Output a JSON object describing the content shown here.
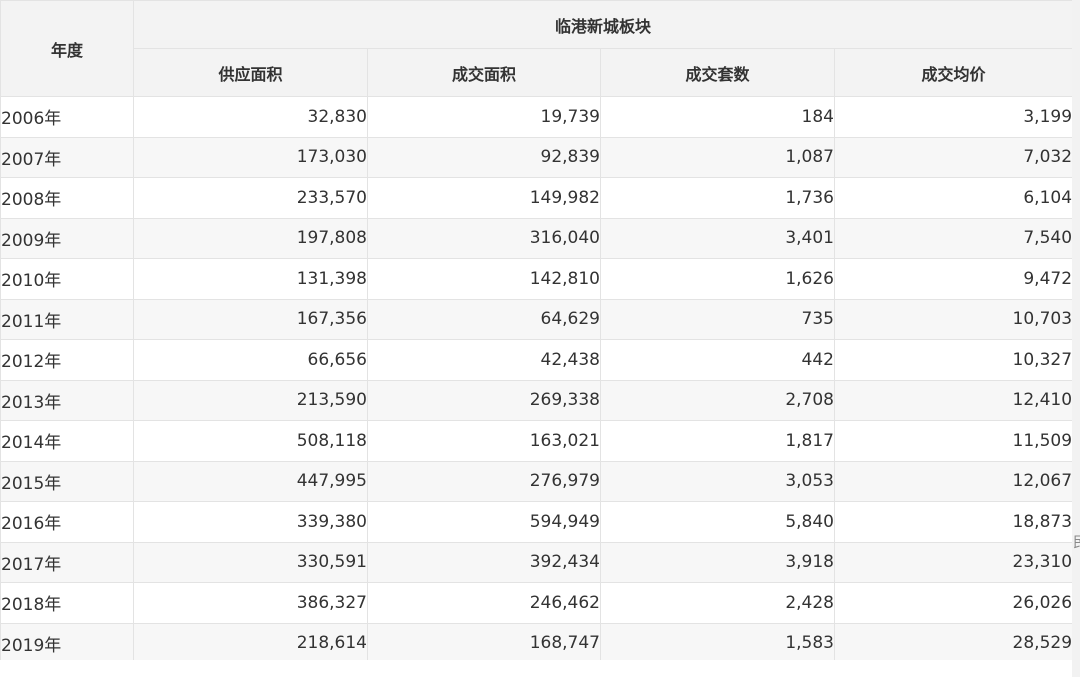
{
  "table": {
    "group_header": "临港新城板块",
    "year_header": "年度",
    "columns": [
      "供应面积",
      "成交面积",
      "成交套数",
      "成交均价"
    ],
    "rows": [
      {
        "year": "2006年",
        "values": [
          "32,830",
          "19,739",
          "184",
          "3,199"
        ]
      },
      {
        "year": "2007年",
        "values": [
          "173,030",
          "92,839",
          "1,087",
          "7,032"
        ]
      },
      {
        "year": "2008年",
        "values": [
          "233,570",
          "149,982",
          "1,736",
          "6,104"
        ]
      },
      {
        "year": "2009年",
        "values": [
          "197,808",
          "316,040",
          "3,401",
          "7,540"
        ]
      },
      {
        "year": "2010年",
        "values": [
          "131,398",
          "142,810",
          "1,626",
          "9,472"
        ]
      },
      {
        "year": "2011年",
        "values": [
          "167,356",
          "64,629",
          "735",
          "10,703"
        ]
      },
      {
        "year": "2012年",
        "values": [
          "66,656",
          "42,438",
          "442",
          "10,327"
        ]
      },
      {
        "year": "2013年",
        "values": [
          "213,590",
          "269,338",
          "2,708",
          "12,410"
        ]
      },
      {
        "year": "2014年",
        "values": [
          "508,118",
          "163,021",
          "1,817",
          "11,509"
        ]
      },
      {
        "year": "2015年",
        "values": [
          "447,995",
          "276,979",
          "3,053",
          "12,067"
        ]
      },
      {
        "year": "2016年",
        "values": [
          "339,380",
          "594,949",
          "5,840",
          "18,873"
        ]
      },
      {
        "year": "2017年",
        "values": [
          "330,591",
          "392,434",
          "3,918",
          "23,310"
        ]
      },
      {
        "year": "2018年",
        "values": [
          "386,327",
          "246,462",
          "2,428",
          "26,026"
        ]
      },
      {
        "year": "2019年",
        "values": [
          "218,614",
          "168,747",
          "1,583",
          "28,529"
        ]
      }
    ]
  },
  "edge_fragment": "民"
}
